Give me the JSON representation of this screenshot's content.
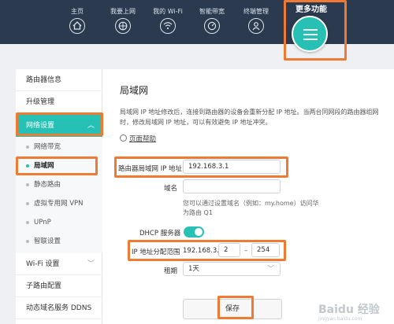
{
  "nav": {
    "items": [
      {
        "label": "主页",
        "icon": "home-icon"
      },
      {
        "label": "我要上网",
        "icon": "globe-icon"
      },
      {
        "label": "我的 Wi-Fi",
        "icon": "wifi-icon"
      },
      {
        "label": "智能带宽",
        "icon": "bandwidth-icon"
      },
      {
        "label": "终端管理",
        "icon": "user-icon"
      }
    ],
    "more_label": "更多功能",
    "more_icon": "menu-icon"
  },
  "sidebar": {
    "router_info": "路由器信息",
    "upgrade": "升级管理",
    "network_settings": "网络设置",
    "sub": [
      "网络带宽",
      "局域网",
      "静态路由",
      "虚拟专用网 VPN",
      "UPnP",
      "智联设置"
    ],
    "wifi_settings": "Wi-Fi 设置",
    "child_router": "子路由配置",
    "ddns": "动态域名服务 DDNS"
  },
  "lan": {
    "title": "局域网",
    "description": "局域网 IP 地址修改后，连接到路由器的设备会重新分配 IP 地址。当两台同网段的路由器组网时，修改局域网 IP 地址，可以有效避免 IP 地址冲突。",
    "help": "页面帮助",
    "ip_label": "路由器局域网 IP 地址",
    "ip_value": "192.168.3.1",
    "domain_label": "域名",
    "domain_value": "",
    "domain_hint": "您可以通过设置域名（例如：my.home）访问华为路由 Q1",
    "dhcp_label": "DHCP 服务器",
    "dhcp_on": true,
    "range_label": "IP 地址分配范围",
    "range_prefix": "192.168.3.",
    "range_start": "2",
    "range_sep": "–",
    "range_end": "254",
    "lease_label": "租期",
    "lease_value": "1天",
    "save": "保存"
  },
  "watermark": {
    "main": "Baidu 经验",
    "sub": "jingyan.baidu.com"
  },
  "colors": {
    "accent": "#26c1b4",
    "nav_bg": "#2b3a4f",
    "highlight": "#ee7a33"
  }
}
